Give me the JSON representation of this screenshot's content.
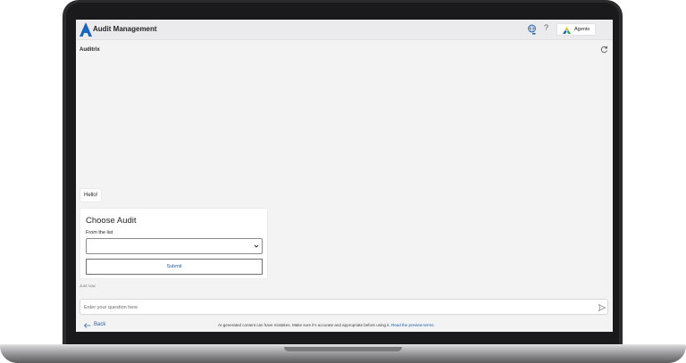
{
  "header": {
    "app_title": "Audit Management",
    "globe_icon": "globe-icon",
    "help_icon": "help-icon",
    "help_glyph": "?",
    "agents_label": "Agents"
  },
  "pane": {
    "title": "Auditrix",
    "refresh_icon": "refresh-icon"
  },
  "chat": {
    "greeting": "Hello!",
    "card": {
      "title": "Choose Audit",
      "field_label": "From the list",
      "selected_value": "",
      "submit_label": "Submit"
    },
    "timestamp": "Just now"
  },
  "composer": {
    "placeholder": "Enter your question here",
    "send_icon": "send-icon"
  },
  "footer": {
    "back_label": "Back",
    "disclaimer_text": "AI-generated content can have mistakes. Make sure it's accurate and appropriate before using it.",
    "disclaimer_link": "Read the preview terms."
  },
  "colors": {
    "brand_blue": "#1f5fa6",
    "screen_bg": "#f3f3f3",
    "topbar_bg": "#ebebed",
    "logo_blue": "#1565c0",
    "logo_yellow": "#f4b400"
  }
}
